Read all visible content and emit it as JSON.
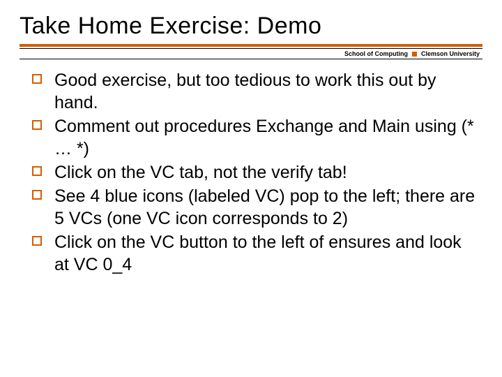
{
  "title": "Take Home Exercise: Demo",
  "subheader": {
    "left": "School of Computing",
    "right": "Clemson University"
  },
  "bullets": [
    "Good exercise, but too tedious to work this out by hand.",
    "Comment out procedures Exchange and Main using (* … *)",
    "Click on the VC tab, not the verify tab!",
    "See 4 blue icons (labeled VC) pop to the left; there are 5 VCs (one VC icon corresponds to 2)",
    "Click on the VC button to the left of ensures and look at VC 0_4"
  ]
}
